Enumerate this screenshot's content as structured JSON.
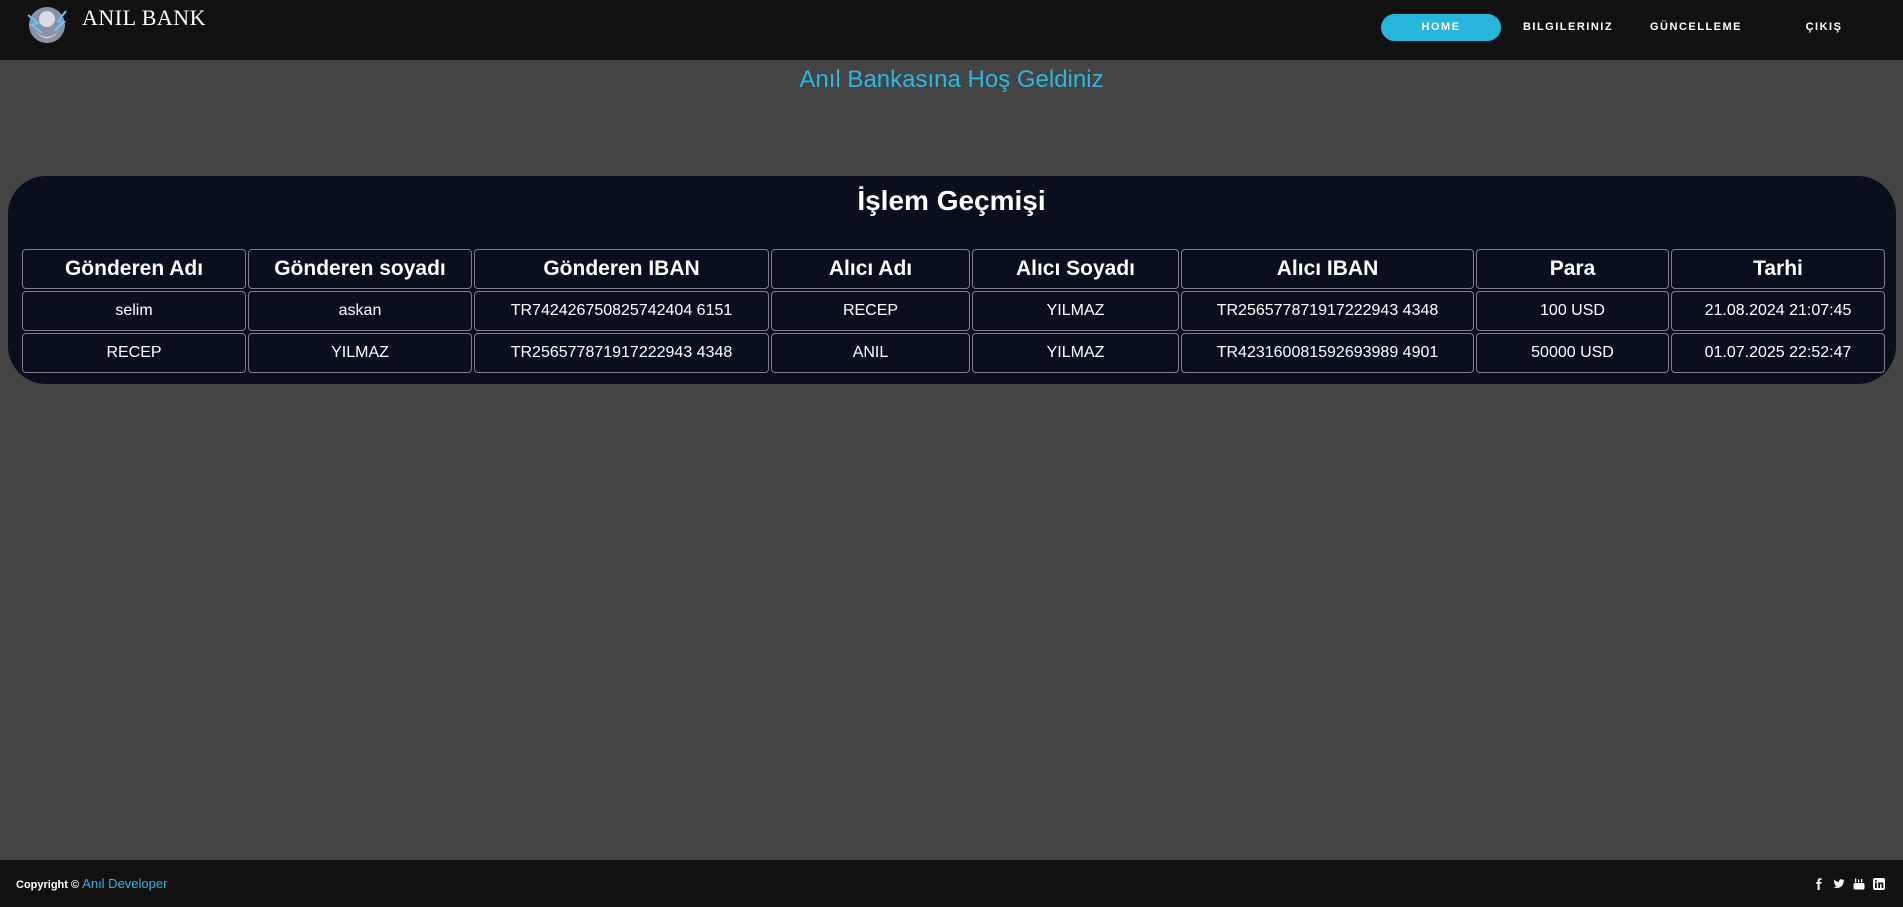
{
  "brand": {
    "name": "ANIL BANK"
  },
  "nav": {
    "items": [
      {
        "label": "HOME",
        "active": true
      },
      {
        "label": "BILGILERINIZ",
        "active": false
      },
      {
        "label": "GÜNCELLEME",
        "active": false
      },
      {
        "label": "ÇIKIŞ",
        "active": false
      }
    ]
  },
  "welcome": "Anıl Bankasına Hoş Geldiniz",
  "history": {
    "title": "İşlem Geçmişi",
    "columns": [
      "Gönderen Adı",
      "Gönderen soyadı",
      "Gönderen IBAN",
      "Alıcı Adı",
      "Alıcı Soyadı",
      "Alıcı IBAN",
      "Para",
      "Tarhi"
    ],
    "rows": [
      [
        "selim",
        "askan",
        "TR742426750825742404 6151",
        "RECEP",
        "YILMAZ",
        "TR256577871917222943 4348",
        "100 USD",
        "21.08.2024 21:07:45"
      ],
      [
        "RECEP",
        "YILMAZ",
        "TR256577871917222943 4348",
        "ANIL",
        "YILMAZ",
        "TR423160081592693989 4901",
        "50000 USD",
        "01.07.2025 22:52:47"
      ]
    ]
  },
  "footer": {
    "copyright": "Copyright ©",
    "developer": "Anıl Developer",
    "social": [
      "facebook-icon",
      "twitter-icon",
      "youtube-icon",
      "linkedin-icon"
    ]
  },
  "colors": {
    "accent": "#26b6dc",
    "panel": "#0a0f1e",
    "background": "#444444",
    "bar": "#111111"
  }
}
